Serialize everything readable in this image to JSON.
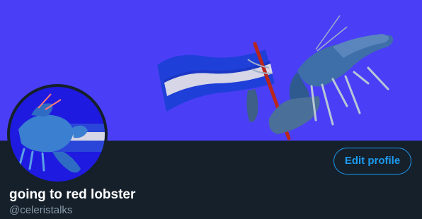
{
  "profile": {
    "display_name": "going to red lobster",
    "handle": "@celeristalks",
    "edit_button_label": "Edit profile"
  },
  "colors": {
    "banner_background": "#4a3ff7",
    "page_background": "#15202b",
    "accent": "#1d9bf0",
    "name_text": "#ffffff",
    "handle_text": "#8899a6",
    "flag_blue": "#1f3fd9",
    "flag_stripe": "#d6d6e6",
    "flag_pole": "#b8261e",
    "lobster_blue": "#3e6fa8"
  }
}
